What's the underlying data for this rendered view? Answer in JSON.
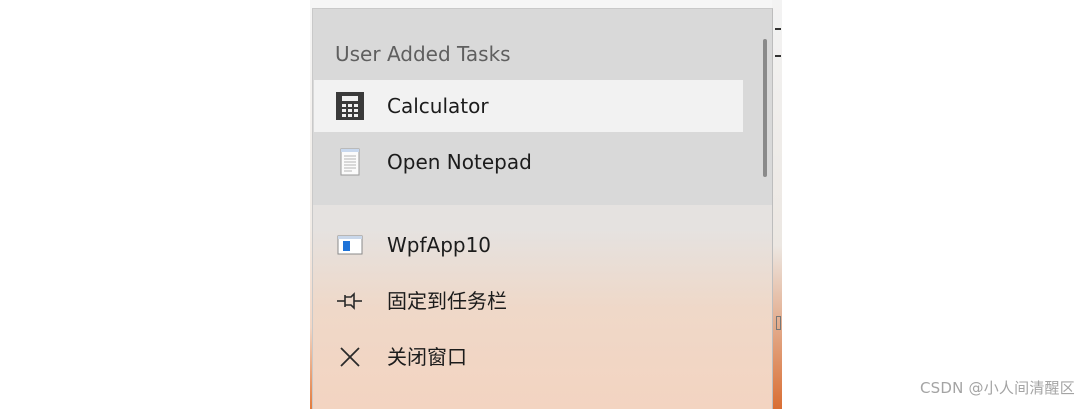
{
  "jumplist": {
    "section_heading": "User Added Tasks",
    "tasks": [
      {
        "label": "Calculator",
        "icon": "calculator-icon"
      },
      {
        "label": "Open Notepad",
        "icon": "notepad-icon"
      }
    ],
    "items": [
      {
        "label": "WpfApp10",
        "icon": "app-window-icon"
      },
      {
        "label": "固定到任务栏",
        "icon": "pin-icon"
      },
      {
        "label": "关闭窗口",
        "icon": "close-icon"
      }
    ]
  },
  "watermark": "CSDN @小人间清醒区",
  "colors": {
    "tasks_background": "#d9d9d9",
    "hover_background": "#f2f2f2",
    "accent_blue": "#1e73d8",
    "taskbar_orange": "#e27a3c"
  }
}
